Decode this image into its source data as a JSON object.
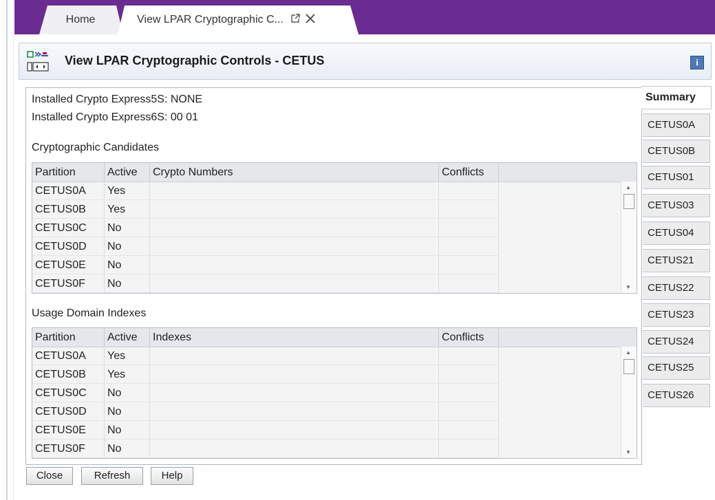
{
  "tabs": {
    "home_label": "Home",
    "active_label": "View LPAR Cryptographic C...",
    "popout_icon": "popout-icon",
    "close_icon": "close-icon"
  },
  "header": {
    "title": "View LPAR Cryptographic Controls - CETUS",
    "info_label": "i"
  },
  "info": {
    "crypto5s": "Installed Crypto Express5S: NONE",
    "crypto6s": "Installed Crypto Express6S: 00 01"
  },
  "candidates": {
    "heading": "Cryptographic Candidates",
    "columns": [
      "Partition",
      "Active",
      "Crypto Numbers",
      "Conflicts"
    ],
    "rows": [
      {
        "partition": "CETUS0A",
        "active": "Yes"
      },
      {
        "partition": "CETUS0B",
        "active": "Yes"
      },
      {
        "partition": "CETUS0C",
        "active": "No"
      },
      {
        "partition": "CETUS0D",
        "active": "No"
      },
      {
        "partition": "CETUS0E",
        "active": "No"
      },
      {
        "partition": "CETUS0F",
        "active": "No"
      }
    ]
  },
  "usage": {
    "heading": "Usage Domain Indexes",
    "columns": [
      "Partition",
      "Active",
      "Indexes",
      "Conflicts"
    ],
    "rows": [
      {
        "partition": "CETUS0A",
        "active": "Yes"
      },
      {
        "partition": "CETUS0B",
        "active": "Yes"
      },
      {
        "partition": "CETUS0C",
        "active": "No"
      },
      {
        "partition": "CETUS0D",
        "active": "No"
      },
      {
        "partition": "CETUS0E",
        "active": "No"
      },
      {
        "partition": "CETUS0F",
        "active": "No"
      }
    ]
  },
  "side_tabs": [
    "Summary",
    "CETUS0A",
    "CETUS0B",
    "CETUS01",
    "CETUS03",
    "CETUS04",
    "CETUS21",
    "CETUS22",
    "CETUS23",
    "CETUS24",
    "CETUS25",
    "CETUS26"
  ],
  "buttons": {
    "close": "Close",
    "refresh": "Refresh",
    "help": "Help"
  },
  "colors": {
    "tabbar": "#6a2c91",
    "info_icon": "#4e79b3"
  }
}
